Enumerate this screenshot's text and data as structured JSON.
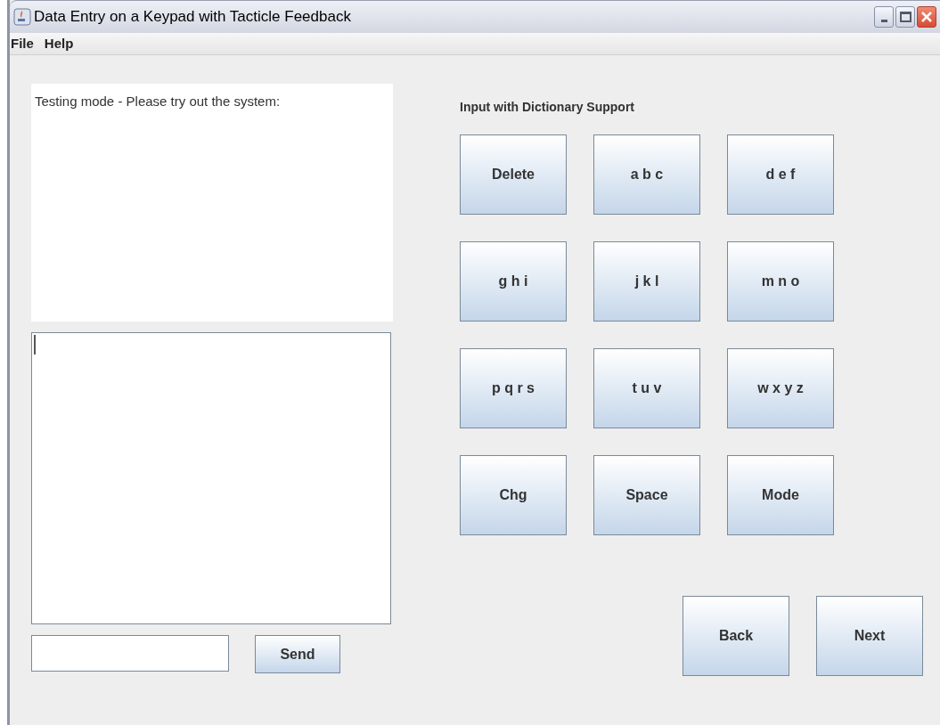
{
  "window": {
    "title": "Data Entry on a Keypad with Tacticle Feedback"
  },
  "menu": [
    "File",
    "Help"
  ],
  "instructions": "Testing mode - Please try out the system:",
  "send_button": "Send",
  "keypad": {
    "title": "Input with Dictionary Support",
    "keys": [
      "Delete",
      "a b c",
      "d e f",
      "g h i",
      "j k l",
      "m n o",
      "p q r s",
      "t u v",
      "w x y z",
      "Chg",
      "Space",
      "Mode"
    ]
  },
  "nav_buttons": [
    "Back",
    "Next"
  ]
}
